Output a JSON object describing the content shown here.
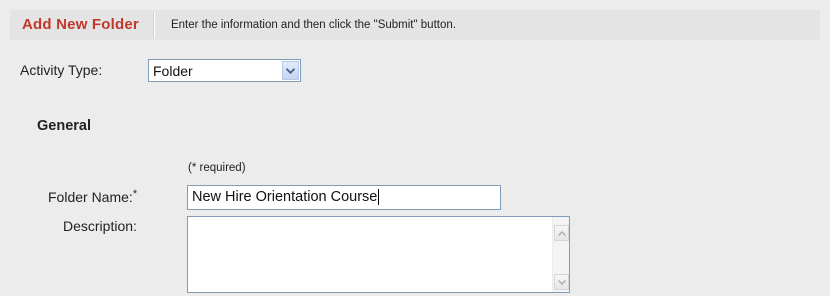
{
  "header": {
    "title": "Add New Folder",
    "instructions": "Enter the information and then click the \"Submit\" button."
  },
  "activity": {
    "label": "Activity Type:",
    "selected": "Folder"
  },
  "section": {
    "title": "General",
    "required_note": "(* required)"
  },
  "folder_name": {
    "label": "Folder Name:",
    "required_marker": "*",
    "value": "New Hire Orientation Course"
  },
  "description": {
    "label": "Description:",
    "value": ""
  },
  "icons": {
    "select_arrow": "chevron-down-icon",
    "scroll_up": "arrow-up-icon",
    "scroll_down": "arrow-down-icon"
  },
  "colors": {
    "title_red": "#c0392b",
    "border_blue": "#7f9db9",
    "background": "#ececec"
  }
}
